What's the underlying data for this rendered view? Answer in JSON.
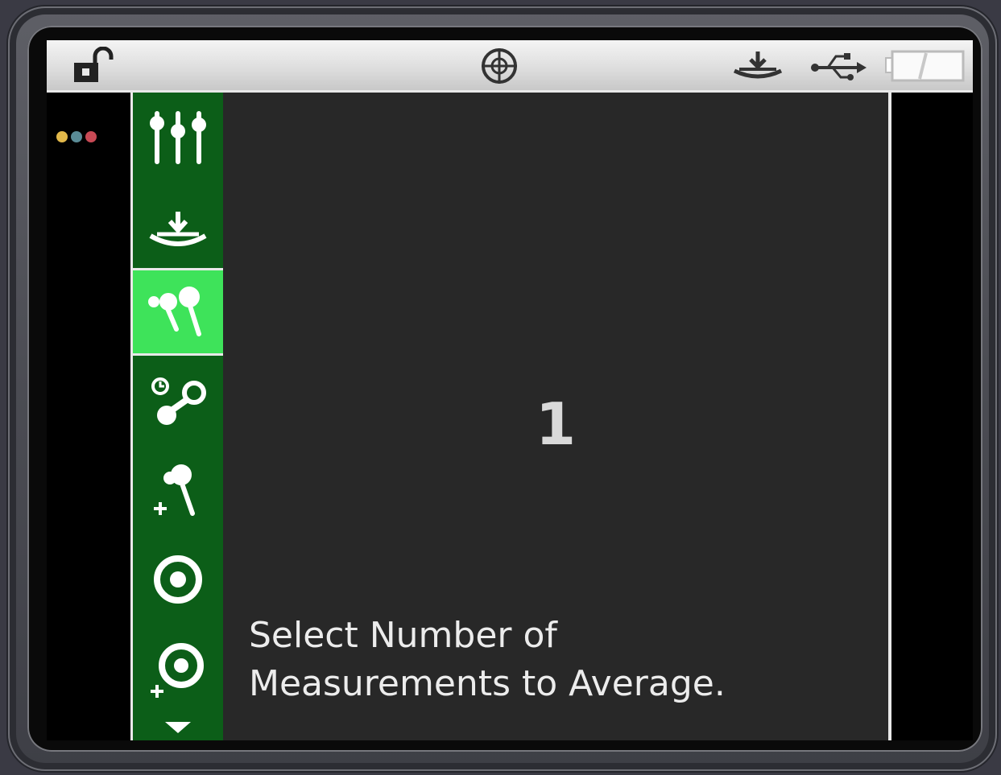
{
  "topbar": {
    "icons": [
      "unlock-icon",
      "target-crosshair-icon",
      "download-receive-icon",
      "usb-icon",
      "battery-icon"
    ]
  },
  "status_dots": {
    "colors": [
      "#e2b84a",
      "#5a8b96",
      "#c84a55"
    ]
  },
  "sidebar": {
    "items": [
      {
        "icon": "sliders-settings-icon",
        "selected": false
      },
      {
        "icon": "receive-download-icon",
        "selected": false
      },
      {
        "icon": "measure-pins-icon",
        "selected": true
      },
      {
        "icon": "timed-connect-icon",
        "selected": false
      },
      {
        "icon": "add-point-icon",
        "selected": false
      },
      {
        "icon": "target-ring-icon",
        "selected": false
      },
      {
        "icon": "add-target-icon",
        "selected": false
      },
      {
        "icon": "scroll-down-arrow-icon",
        "selected": false
      }
    ],
    "accent": "#0c5e18",
    "selected_color": "#3ee35a"
  },
  "main": {
    "value": "1",
    "prompt_line1": "Select Number of",
    "prompt_line2": "Measurements to Average."
  }
}
